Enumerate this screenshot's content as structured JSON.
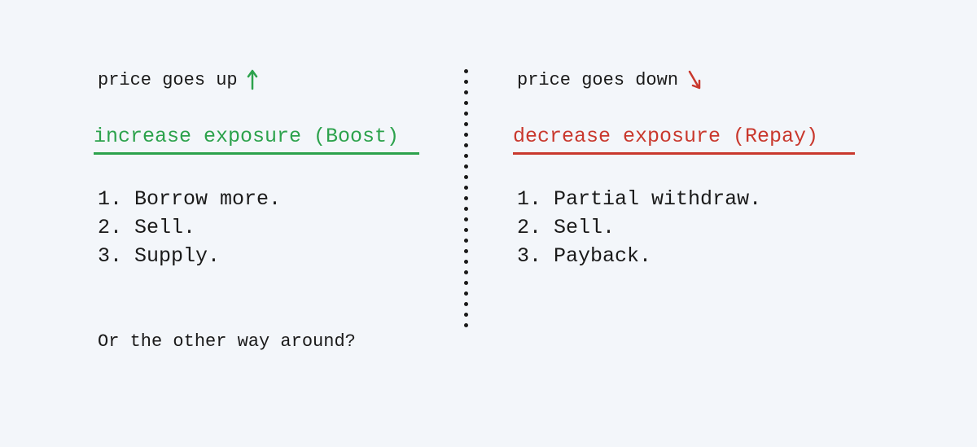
{
  "left": {
    "price_label": "price goes up",
    "headline": "increase exposure (Boost)",
    "steps": [
      "Borrow more.",
      "Sell.",
      "Supply."
    ],
    "color": "#2ca24c"
  },
  "right": {
    "price_label": "price goes down",
    "headline": "decrease exposure (Repay)",
    "steps": [
      "Partial withdraw.",
      "Sell.",
      "Payback."
    ],
    "color": "#c9382d"
  },
  "footnote": "Or the other way around?",
  "icons": {
    "arrow_up": "arrow-up-icon",
    "arrow_down": "arrow-down-icon"
  }
}
